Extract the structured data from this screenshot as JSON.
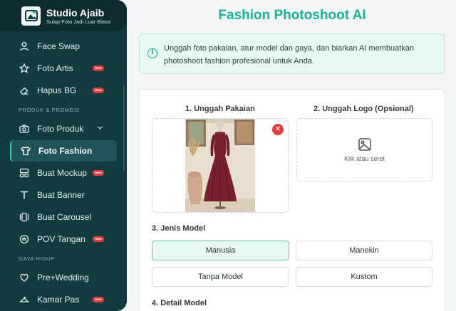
{
  "brand": {
    "name": "Studio Ajaib",
    "tagline": "Sulap Foto Jadi Luar Biasa"
  },
  "sidebar": {
    "items_top": [
      {
        "label": "Face Swap",
        "icon": "user-icon",
        "badge": ""
      },
      {
        "label": "Foto Artis",
        "icon": "star-icon",
        "badge": "New"
      },
      {
        "label": "Hapus BG",
        "icon": "eraser-icon",
        "badge": "New"
      }
    ],
    "section_produk": "PRODUK & PROMOSI",
    "items_produk": [
      {
        "label": "Foto Produk",
        "icon": "camera-icon",
        "badge": ""
      },
      {
        "label": "Foto Fashion",
        "icon": "shirt-icon",
        "badge": ""
      },
      {
        "label": "Buat Mockup",
        "icon": "layout-icon",
        "badge": "New"
      },
      {
        "label": "Buat Banner",
        "icon": "text-icon",
        "badge": ""
      },
      {
        "label": "Buat Carousel",
        "icon": "carousel-icon",
        "badge": ""
      },
      {
        "label": "POV Tangan",
        "icon": "hand-icon",
        "badge": "New"
      }
    ],
    "section_gaya": "GAYA HIDUP",
    "items_gaya": [
      {
        "label": "Pre+Wedding",
        "icon": "heart-icon",
        "badge": ""
      },
      {
        "label": "Kamar Pas",
        "icon": "hanger-icon",
        "badge": "New"
      }
    ],
    "active": "Foto Fashion"
  },
  "main": {
    "title": "Fashion Photoshoot AI",
    "info": "Unggah foto pakaian, atur model dan gaya, dan biarkan AI membuatkan photoshoot fashion profesional untuk Anda.",
    "upload_clothing_label": "1. Unggah Pakaian",
    "upload_logo_label": "2. Unggah Logo (Opsional)",
    "upload_logo_hint": "Klik atau seret",
    "model_type_label": "3. Jenis Model",
    "model_options": [
      "Manusia",
      "Manekin",
      "Tanpa Model",
      "Kustom"
    ],
    "model_selected": "Manusia",
    "model_detail_label": "4. Detail Model"
  },
  "colors": {
    "accent": "#16b197",
    "sidebar": "#123b3f",
    "badge": "#e43d3d",
    "dress": "#7a1f2e"
  }
}
